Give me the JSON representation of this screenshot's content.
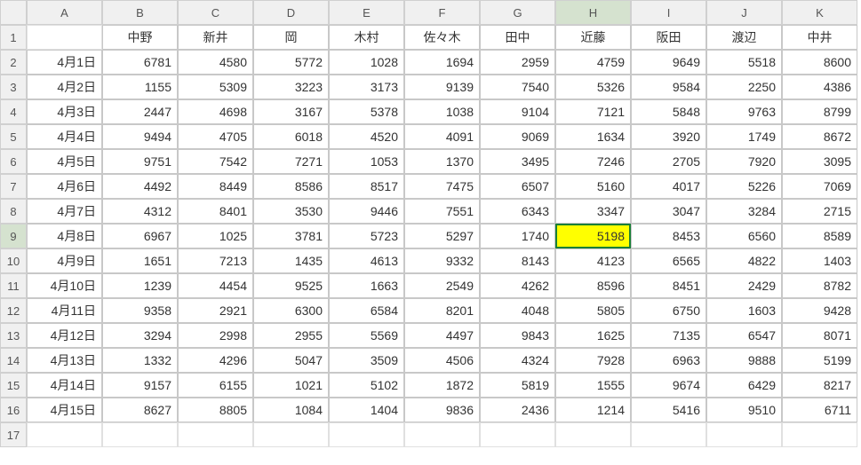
{
  "chart_data": {
    "type": "table",
    "title": "",
    "columns": [
      "中野",
      "新井",
      "岡",
      "木村",
      "佐々木",
      "田中",
      "近藤",
      "阪田",
      "渡辺",
      "中井"
    ],
    "rows": [
      "4月1日",
      "4月2日",
      "4月3日",
      "4月4日",
      "4月5日",
      "4月6日",
      "4月7日",
      "4月8日",
      "4月9日",
      "4月10日",
      "4月11日",
      "4月12日",
      "4月13日",
      "4月14日",
      "4月15日"
    ],
    "data": [
      [
        6781,
        4580,
        5772,
        1028,
        1694,
        2959,
        4759,
        9649,
        5518,
        8600
      ],
      [
        1155,
        5309,
        3223,
        3173,
        9139,
        7540,
        5326,
        9584,
        2250,
        4386
      ],
      [
        2447,
        4698,
        3167,
        5378,
        1038,
        9104,
        7121,
        5848,
        9763,
        8799
      ],
      [
        9494,
        4705,
        6018,
        4520,
        4091,
        9069,
        1634,
        3920,
        1749,
        8672
      ],
      [
        9751,
        7542,
        7271,
        1053,
        1370,
        3495,
        7246,
        2705,
        7920,
        3095
      ],
      [
        4492,
        8449,
        8586,
        8517,
        7475,
        6507,
        5160,
        4017,
        5226,
        7069
      ],
      [
        4312,
        8401,
        3530,
        9446,
        7551,
        6343,
        3347,
        3047,
        3284,
        2715
      ],
      [
        6967,
        1025,
        3781,
        5723,
        5297,
        1740,
        5198,
        8453,
        6560,
        8589
      ],
      [
        1651,
        7213,
        1435,
        4613,
        9332,
        8143,
        4123,
        6565,
        4822,
        1403
      ],
      [
        1239,
        4454,
        9525,
        1663,
        2549,
        4262,
        8596,
        8451,
        2429,
        8782
      ],
      [
        9358,
        2921,
        6300,
        6584,
        8201,
        4048,
        5805,
        6750,
        1603,
        9428
      ],
      [
        3294,
        2998,
        2955,
        5569,
        4497,
        9843,
        1625,
        7135,
        6547,
        8071
      ],
      [
        1332,
        4296,
        5047,
        3509,
        4506,
        4324,
        7928,
        6963,
        9888,
        5199
      ],
      [
        9157,
        6155,
        1021,
        5102,
        1872,
        5819,
        1555,
        9674,
        6429,
        8217
      ],
      [
        8627,
        8805,
        1084,
        1404,
        9836,
        2436,
        1214,
        5416,
        9510,
        6711
      ]
    ]
  },
  "colLetters": [
    "A",
    "B",
    "C",
    "D",
    "E",
    "F",
    "G",
    "H",
    "I",
    "J",
    "K"
  ],
  "selectedCol": "H",
  "selectedRow": 9,
  "highlightedCell": {
    "row": 9,
    "col": "H"
  },
  "rowCount": 17
}
